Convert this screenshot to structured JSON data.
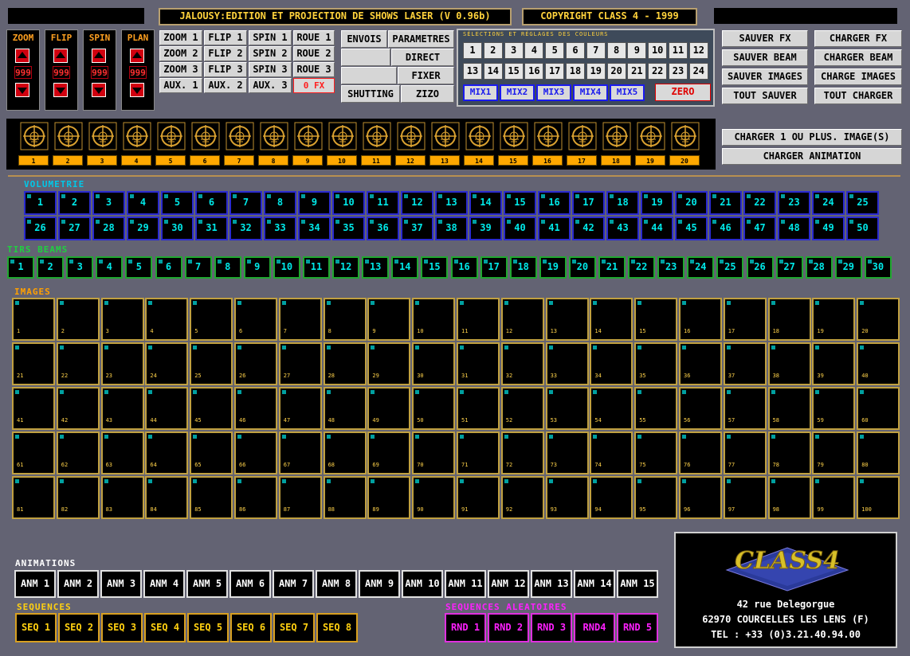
{
  "header": {
    "title": "JALOUSY:EDITION ET PROJECTION DE SHOWS LASER (V 0.96b)",
    "copyright": "COPYRIGHT CLASS 4  -  1999"
  },
  "controls": [
    {
      "label": "ZOOM",
      "value": "999"
    },
    {
      "label": "FLIP",
      "value": "999"
    },
    {
      "label": "SPIN",
      "value": "999"
    },
    {
      "label": "PLAN",
      "value": "999"
    }
  ],
  "fx_buttons": [
    [
      "ZOOM 1",
      "FLIP 1",
      "SPIN 1",
      "ROUE 1"
    ],
    [
      "ZOOM 2",
      "FLIP 2",
      "SPIN 2",
      "ROUE 2"
    ],
    [
      "ZOOM 3",
      "FLIP 3",
      "SPIN 3",
      "ROUE 3"
    ],
    [
      "AUX. 1",
      "AUX. 2",
      "AUX. 3",
      "0 FX"
    ]
  ],
  "mode_buttons": {
    "envois": "ENVOIS",
    "parametres": "PARAMETRES",
    "direct": "DIRECT",
    "fixer": "FIXER",
    "shutting": "SHUTTING",
    "zizo": "ZIZO"
  },
  "colors": {
    "title": "SÉLECTIONS ET RÉGLAGES DES COULEURS",
    "row1": [
      "1",
      "2",
      "3",
      "4",
      "5",
      "6",
      "7",
      "8",
      "9",
      "10",
      "11",
      "12"
    ],
    "row2": [
      "13",
      "14",
      "15",
      "16",
      "17",
      "18",
      "19",
      "20",
      "21",
      "22",
      "23",
      "24"
    ],
    "mixes": [
      "MIX1",
      "MIX2",
      "MIX3",
      "MIX4",
      "MIX5"
    ],
    "zero": "ZERO"
  },
  "file_buttons": [
    [
      "SAUVER FX",
      "CHARGER FX"
    ],
    [
      "SAUVER BEAM",
      "CHARGER BEAM"
    ],
    [
      "SAUVER IMAGES",
      "CHARGE IMAGES"
    ],
    [
      "TOUT SAUVER",
      "TOUT CHARGER"
    ]
  ],
  "load_buttons": {
    "images": "CHARGER 1 OU PLUS. IMAGE(S)",
    "animation": "CHARGER ANIMATION"
  },
  "projectors": [
    "1",
    "2",
    "3",
    "4",
    "5",
    "6",
    "7",
    "8",
    "9",
    "10",
    "11",
    "12",
    "13",
    "14",
    "15",
    "16",
    "17",
    "18",
    "19",
    "20"
  ],
  "sections": {
    "volumetrie": "VOLUMETRIE",
    "tirs_beams": "TIRS BEAMS",
    "images": "IMAGES",
    "animations": "ANIMATIONS",
    "sequences": "SEQUENCES",
    "sequences_aleatoires": "SEQUENCES ALEATOIRES"
  },
  "volumetrie": [
    "1",
    "2",
    "3",
    "4",
    "5",
    "6",
    "7",
    "8",
    "9",
    "10",
    "11",
    "12",
    "13",
    "14",
    "15",
    "16",
    "17",
    "18",
    "19",
    "20",
    "21",
    "22",
    "23",
    "24",
    "25",
    "26",
    "27",
    "28",
    "29",
    "30",
    "31",
    "32",
    "33",
    "34",
    "35",
    "36",
    "37",
    "38",
    "39",
    "40",
    "41",
    "42",
    "43",
    "44",
    "45",
    "46",
    "47",
    "48",
    "49",
    "50"
  ],
  "tirs_beams": [
    "1",
    "2",
    "3",
    "4",
    "5",
    "6",
    "7",
    "8",
    "9",
    "10",
    "11",
    "12",
    "13",
    "14",
    "15",
    "16",
    "17",
    "18",
    "19",
    "20",
    "21",
    "22",
    "23",
    "24",
    "25",
    "26",
    "27",
    "28",
    "29",
    "30"
  ],
  "images": [
    "1",
    "2",
    "3",
    "4",
    "5",
    "6",
    "7",
    "8",
    "9",
    "10",
    "11",
    "12",
    "13",
    "14",
    "15",
    "16",
    "17",
    "18",
    "19",
    "20",
    "21",
    "22",
    "23",
    "24",
    "25",
    "26",
    "27",
    "28",
    "29",
    "30",
    "31",
    "32",
    "33",
    "34",
    "35",
    "36",
    "37",
    "38",
    "39",
    "40",
    "41",
    "42",
    "43",
    "44",
    "45",
    "46",
    "47",
    "48",
    "49",
    "50",
    "51",
    "52",
    "53",
    "54",
    "55",
    "56",
    "57",
    "58",
    "59",
    "60",
    "61",
    "62",
    "63",
    "64",
    "65",
    "66",
    "67",
    "68",
    "69",
    "70",
    "71",
    "72",
    "73",
    "74",
    "75",
    "76",
    "77",
    "78",
    "79",
    "80",
    "81",
    "82",
    "83",
    "84",
    "85",
    "86",
    "87",
    "88",
    "89",
    "90",
    "91",
    "92",
    "93",
    "94",
    "95",
    "96",
    "97",
    "98",
    "99",
    "100"
  ],
  "animations": [
    "ANM 1",
    "ANM 2",
    "ANM 3",
    "ANM 4",
    "ANM 5",
    "ANM 6",
    "ANM 7",
    "ANM 8",
    "ANM 9",
    "ANM 10",
    "ANM 11",
    "ANM 12",
    "ANM 13",
    "ANM 14",
    "ANM 15"
  ],
  "sequences": [
    "SEQ 1",
    "SEQ 2",
    "SEQ 3",
    "SEQ 4",
    "SEQ 5",
    "SEQ 6",
    "SEQ 7",
    "SEQ 8"
  ],
  "random_sequences": [
    "RND 1",
    "RND 2",
    "RND 3",
    "RND4",
    "RND 5"
  ],
  "company": {
    "logo_text": "CLASS4",
    "address1": "42 rue Delegorgue",
    "address2": "62970 COURCELLES LES LENS (F)",
    "phone": "TEL : +33 (0)3.21.40.94.00"
  }
}
